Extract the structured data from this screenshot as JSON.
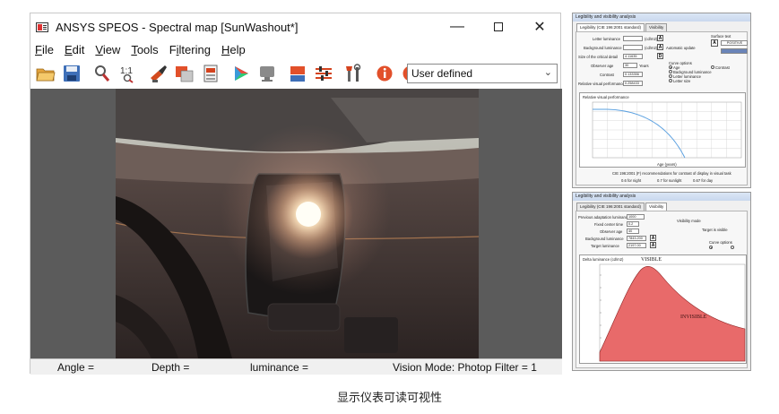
{
  "window": {
    "title": "ANSYS SPEOS - Spectral map [SunWashout*]",
    "controls": {
      "minimize": "—",
      "maximize": "",
      "close": "✕"
    }
  },
  "menu": [
    {
      "key": "F",
      "rest": "ile"
    },
    {
      "key": "E",
      "rest": "dit"
    },
    {
      "key": "V",
      "rest": "iew"
    },
    {
      "key": "T",
      "rest": "ools"
    },
    {
      "key": "",
      "pre": "F",
      "key2": "i",
      "rest": "ltering"
    },
    {
      "key": "H",
      "rest": "elp"
    }
  ],
  "menu_labels": [
    "File",
    "Edit",
    "View",
    "Tools",
    "Filtering",
    "Help"
  ],
  "toolbar": {
    "icons": [
      "open-folder-icon",
      "save-icon",
      "zoom-icon",
      "one-to-one-icon",
      "brush-icon",
      "layers-icon",
      "document-icon",
      "color-wheel-icon",
      "monitor-icon",
      "shapes-icon",
      "sliders-icon",
      "tools-icon",
      "info-icon",
      "help-icon"
    ],
    "one_to_one_label": "1:1",
    "view_mode": "User defined"
  },
  "status": {
    "angle": "Angle =",
    "depth": "Depth =",
    "luminance": "luminance =",
    "vision": "Vision Mode: Photop Filter = 1"
  },
  "panel1": {
    "title": "Legibility and visibility analysis",
    "tabs": [
      "Legibility (CIE 196:2001 standard)",
      "Visibility"
    ],
    "fields": [
      {
        "label": "Letter luminance",
        "value": "(cd/m2)"
      },
      {
        "label": "Background luminance",
        "value": "(cd/m2)"
      },
      {
        "label": "Size of the critical detail",
        "value": "4.11635"
      },
      {
        "label": "Observer age",
        "value": "30"
      },
      {
        "label": "Contrast",
        "value": "0.133356"
      },
      {
        "label": "Relative visual performance",
        "value": "0.258433"
      }
    ],
    "unit_years": "Years",
    "automatic_update": "Automatic update",
    "surface_text": "Surface text",
    "positive": "POSITIVE",
    "curve_options": "Curve options",
    "curve_items": [
      "Age",
      "Background luminance",
      "Letter luminance",
      "Letter size"
    ],
    "contrast": "Contrast",
    "chart_title": "Relative visual performance",
    "xlabel": "Age (years)",
    "footer": "CIE 196:2001 (F) recommendations for contrast of display in visual task",
    "footer_items": [
      "0.6 for night",
      "0.7 for sunlight",
      "0.67 for day"
    ]
  },
  "panel2": {
    "title": "Legibility and visibility analysis",
    "tabs": [
      "Legibility (CIE 196:2001 standard)",
      "Visibility"
    ],
    "fields": [
      {
        "label": "Previous adaptation luminance",
        "value": "1000"
      },
      {
        "label": "Fixed center time",
        "value": "0.2"
      },
      {
        "label": "Observer age",
        "value": "40"
      },
      {
        "label": "Background luminance",
        "value": "7843.200"
      },
      {
        "label": "Target luminance",
        "value": "2197.00"
      }
    ],
    "visibility_mode": "Visibility mode",
    "target_visible": "Target is visible",
    "curve_options": "Curve options",
    "chart_ylabel": "Delta luminance (cd/m2)",
    "visible": "VISIBLE",
    "invisible": "INVISIBLE"
  },
  "caption": "显示仪表可读可视性",
  "colors": {
    "invisible_fill": "#e86a6a",
    "curve_blue": "#5aa0e0",
    "titlebar": "#ffffff"
  }
}
